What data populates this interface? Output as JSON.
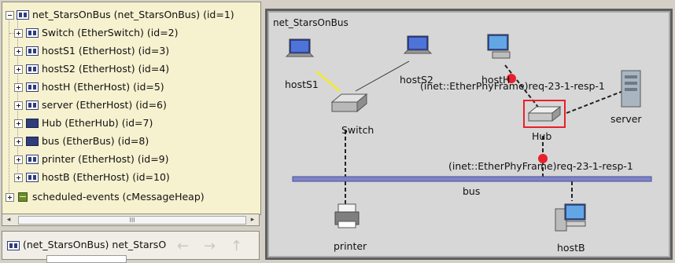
{
  "tree": {
    "root": "net_StarsOnBus (net_StarsOnBus) (id=1)",
    "children": [
      "Switch (EtherSwitch) (id=2)",
      "hostS1 (EtherHost) (id=3)",
      "hostS2 (EtherHost) (id=4)",
      "hostH (EtherHost) (id=5)",
      "server (EtherHost) (id=6)",
      "Hub (EtherHub) (id=7)",
      "bus (EtherBus) (id=8)",
      "printer (EtherHost) (id=9)",
      "hostB (EtherHost) (id=10)"
    ],
    "events": "scheduled-events (cMessageHeap)"
  },
  "scrollbar": {
    "left_arrow": "◂",
    "right_arrow": "▸",
    "thumb_grip": "III"
  },
  "bottom_bar": {
    "label": "(net_StarsOnBus) net_StarsO",
    "back": "←",
    "forward": "→",
    "up": "↑"
  },
  "canvas": {
    "title": "net_StarsOnBus",
    "nodes": {
      "hostS1": "hostS1",
      "hostS2": "hostS2",
      "hostH": "hostH",
      "switch": "Switch",
      "hub": "Hub",
      "server": "server",
      "bus": "bus",
      "printer": "printer",
      "hostB": "hostB"
    },
    "messages": {
      "upper": "(inet::EtherPhyFrame)req-23-1-resp-1",
      "lower": "(inet::EtherPhyFrame)req-23-1-resp-1"
    },
    "colors": {
      "background": "#d7d7d7",
      "bus": "#7f83c7",
      "message_dot": "#e8202c",
      "highlight": "#e8202c",
      "active_link": "#f4ea2a"
    }
  }
}
